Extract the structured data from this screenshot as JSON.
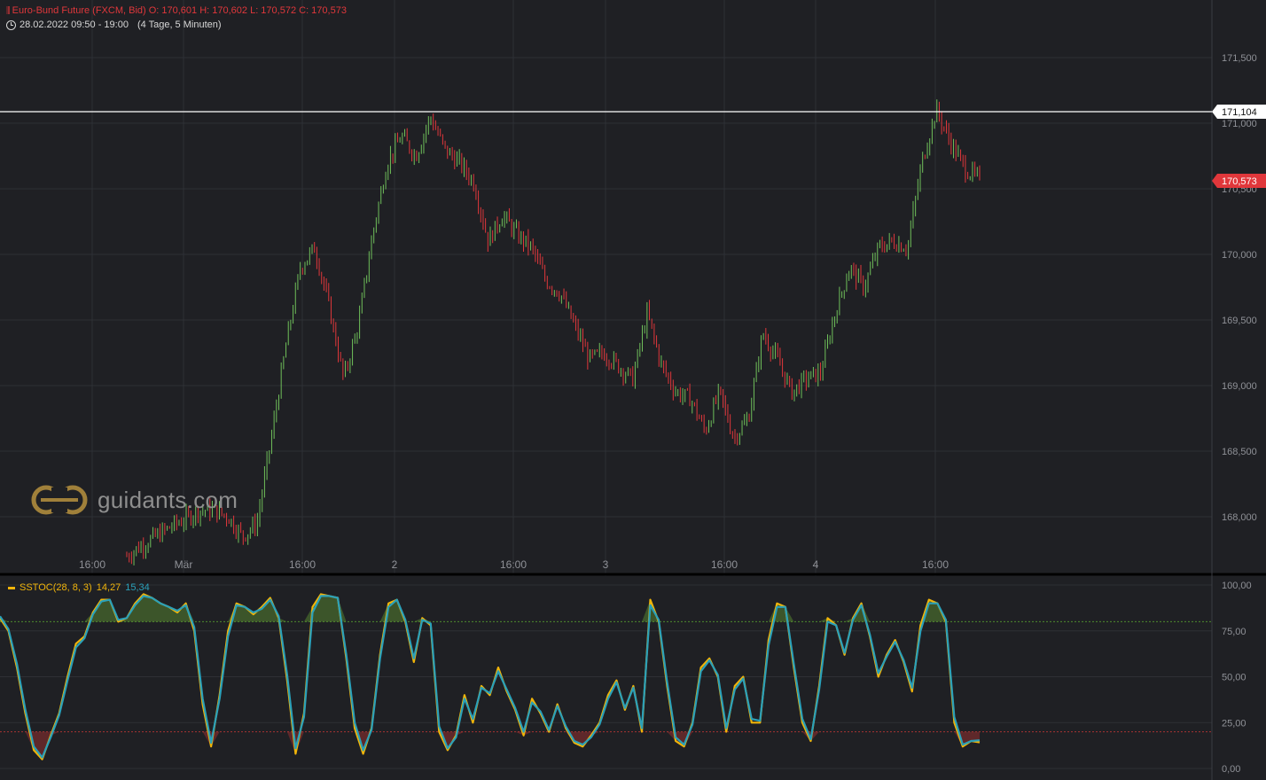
{
  "header": {
    "instrument_icon": "candles-icon",
    "title": "Euro-Bund Future (FXCM, Bid)  O: 170,601  H: 170,602  L: 170,572  C: 170,573",
    "timerange": "28.02.2022 09:50 - 19:00",
    "timespan": "(4 Tage, 5 Minuten)"
  },
  "logo": {
    "text": "guidants.com"
  },
  "price_axis": {
    "ticks": [
      "171,500",
      "171,000",
      "170,500",
      "170,000",
      "169,500",
      "169,000",
      "168,500",
      "168,000"
    ],
    "marker_line": "171,104",
    "last_price": "170,573"
  },
  "time_axis": [
    "16:00",
    "Mär",
    "16:00",
    "2",
    "16:00",
    "3",
    "16:00",
    "4",
    "16:00"
  ],
  "indicator": {
    "name": "SSTOC(28, 8, 3)",
    "value_k": "14,27",
    "value_d": "15,34",
    "ticks": [
      "100,00",
      "75,00",
      "50,00",
      "25,00",
      "0,00"
    ],
    "upper_level": 80,
    "lower_level": 20
  },
  "colors": {
    "background": "#1f2024",
    "grid": "#2e3035",
    "up": "#6fbf5a",
    "down": "#e0373b",
    "k_line": "#f0b40a",
    "d_line": "#2aa0b9",
    "marker": "#ffffff"
  },
  "chart_data": [
    {
      "type": "candlestick",
      "title": "Euro-Bund Future (FXCM, Bid)",
      "interval": "5 Minuten",
      "ylim": [
        167.7,
        171.85
      ],
      "horizontal_line": 171.104,
      "last": 170.573,
      "ohlc": {
        "open": 170.601,
        "high": 170.602,
        "low": 170.572,
        "close": 170.573
      },
      "x": [
        "28.02 09:50",
        "28.02 16:00",
        "01.03 00:00",
        "01.03 16:00",
        "02.03 00:00",
        "02.03 16:00",
        "03.03 00:00",
        "03.03 16:00",
        "04.03 00:00",
        "04.03 16:00",
        "04.03 19:00"
      ],
      "series": [
        {
          "values": [
            167.7,
            167.78,
            167.85,
            167.92,
            167.98,
            168.05,
            168.05,
            168.0,
            167.85,
            167.95,
            168.6,
            169.3,
            169.9,
            170.05,
            169.6,
            169.05,
            169.45,
            170.15,
            170.7,
            170.9,
            170.75,
            171.05,
            170.8,
            170.7,
            170.55,
            170.1,
            170.3,
            170.15,
            170.05,
            169.8,
            169.7,
            169.45,
            169.2,
            169.25,
            169.15,
            169.05,
            169.55,
            169.15,
            168.95,
            168.9,
            168.65,
            168.95,
            168.6,
            168.75,
            169.4,
            169.2,
            168.95,
            169.05,
            169.1,
            169.55,
            169.9,
            169.75,
            170.05,
            170.1,
            170.05,
            170.7,
            171.1,
            170.85,
            170.65,
            170.57
          ],
          "note_labels": []
        }
      ]
    },
    {
      "type": "line",
      "title": "SSTOC(28, 8, 3)",
      "ylim": [
        0,
        100
      ],
      "reference_lines": [
        80,
        20
      ],
      "series": [
        {
          "name": "14,27",
          "values": [
            82,
            75,
            55,
            30,
            10,
            5,
            18,
            30,
            50,
            68,
            72,
            85,
            92,
            92,
            80,
            82,
            90,
            95,
            93,
            90,
            88,
            85,
            90,
            75,
            35,
            12,
            40,
            75,
            90,
            88,
            84,
            88,
            93,
            82,
            48,
            8,
            30,
            88,
            95,
            94,
            93,
            60,
            22,
            8,
            22,
            62,
            90,
            92,
            80,
            58,
            82,
            78,
            20,
            10,
            18,
            40,
            25,
            45,
            40,
            55,
            42,
            32,
            18,
            38,
            30,
            20,
            35,
            22,
            14,
            12,
            18,
            25,
            40,
            48,
            32,
            45,
            20,
            92,
            80,
            45,
            15,
            12,
            25,
            55,
            60,
            50,
            20,
            45,
            50,
            25,
            25,
            70,
            90,
            88,
            55,
            25,
            15,
            45,
            82,
            78,
            62,
            82,
            90,
            72,
            50,
            62,
            70,
            58,
            42,
            78,
            92,
            90,
            80,
            25,
            12,
            15,
            14.27
          ]
        },
        {
          "name": "15,34",
          "values": [
            83,
            76,
            57,
            32,
            12,
            6,
            17,
            29,
            48,
            66,
            71,
            84,
            91,
            92,
            81,
            82,
            89,
            94,
            93,
            90,
            88,
            86,
            89,
            77,
            38,
            14,
            38,
            72,
            89,
            88,
            85,
            87,
            92,
            83,
            51,
            11,
            28,
            85,
            94,
            94,
            93,
            62,
            25,
            10,
            21,
            60,
            88,
            92,
            81,
            60,
            81,
            79,
            23,
            11,
            17,
            38,
            27,
            44,
            41,
            53,
            43,
            33,
            20,
            36,
            31,
            21,
            34,
            23,
            15,
            13,
            17,
            24,
            38,
            47,
            33,
            44,
            22,
            89,
            81,
            47,
            17,
            13,
            24,
            53,
            59,
            51,
            22,
            43,
            49,
            27,
            26,
            67,
            88,
            88,
            57,
            27,
            16,
            43,
            80,
            78,
            63,
            81,
            89,
            73,
            52,
            61,
            69,
            59,
            44,
            75,
            90,
            90,
            81,
            28,
            13,
            15,
            15.34
          ]
        }
      ]
    }
  ]
}
